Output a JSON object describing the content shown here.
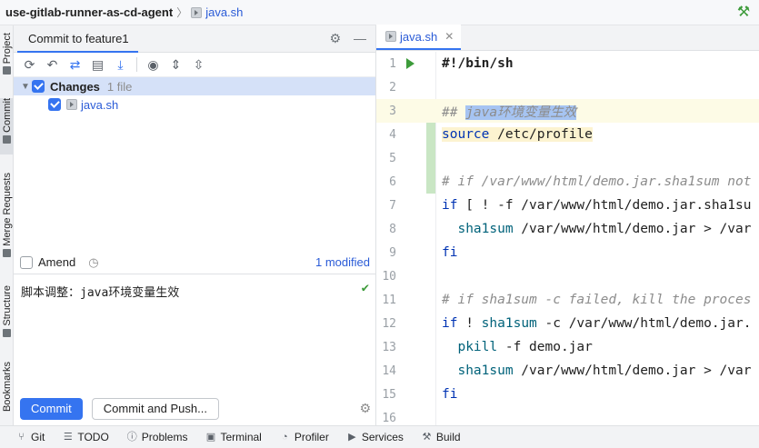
{
  "titlebar": {
    "project": "use-gitlab-runner-as-cd-agent",
    "file": "java.sh"
  },
  "left_strip": {
    "tabs": [
      "Project",
      "Commit",
      "Merge Requests",
      "Structure",
      "Bookmarks"
    ]
  },
  "commit_panel": {
    "tab_title": "Commit to feature1",
    "changes_label": "Changes",
    "changes_count": "1 file",
    "files": [
      "java.sh"
    ],
    "amend_label": "Amend",
    "modified_label": "1 modified",
    "message": "脚本调整：java环境变量生效",
    "commit_button": "Commit",
    "commit_push_button": "Commit and Push..."
  },
  "editor": {
    "tab": "java.sh",
    "lines": [
      {
        "n": "1",
        "html": "<b>#!/bin/sh</b>"
      },
      {
        "n": "2",
        "html": ""
      },
      {
        "n": "3",
        "html": "<span class=\"cm\">## <span class=\"sel\">java环境变量生效</span></span>"
      },
      {
        "n": "4",
        "html": "<span class=\"hl-src\"><span class=\"kw\">source</span> /etc/profile</span>"
      },
      {
        "n": "5",
        "html": ""
      },
      {
        "n": "6",
        "html": "<span class=\"cm\"># if /var/www/html/demo.jar.sha1sum not</span>"
      },
      {
        "n": "7",
        "html": "<span class=\"kw\">if</span> [ ! -f /var/www/html/demo.jar.sha1su"
      },
      {
        "n": "8",
        "html": "  <span class=\"fn\">sha1sum</span> /var/www/html/demo.jar &gt; /var"
      },
      {
        "n": "9",
        "html": "<span class=\"kw\">fi</span>"
      },
      {
        "n": "10",
        "html": ""
      },
      {
        "n": "11",
        "html": "<span class=\"cm\"># if sha1sum -c failed, kill the proces</span>"
      },
      {
        "n": "12",
        "html": "<span class=\"kw\">if</span> ! <span class=\"fn\">sha1sum</span> -c /var/www/html/demo.jar."
      },
      {
        "n": "13",
        "html": "  <span class=\"fn\">pkill</span> -f demo.jar"
      },
      {
        "n": "14",
        "html": "  <span class=\"fn\">sha1sum</span> /var/www/html/demo.jar &gt; /var"
      },
      {
        "n": "15",
        "html": "<span class=\"kw\">fi</span>"
      },
      {
        "n": "16",
        "html": ""
      }
    ]
  },
  "bottombar": {
    "items": [
      "Git",
      "TODO",
      "Problems",
      "Terminal",
      "Profiler",
      "Services",
      "Build"
    ]
  }
}
